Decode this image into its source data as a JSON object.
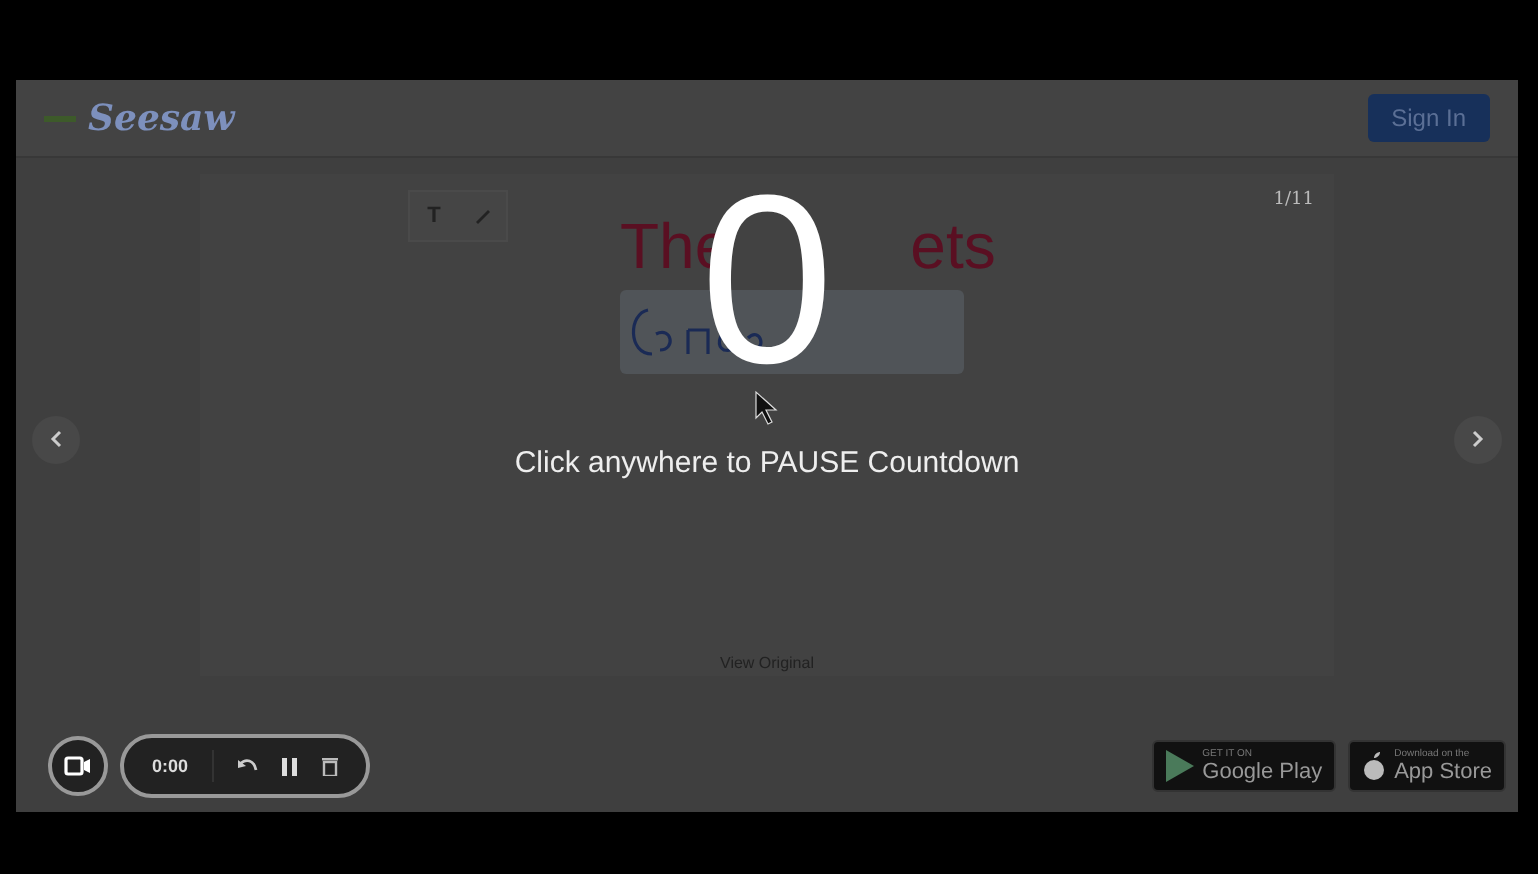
{
  "header": {
    "logo": "Seesaw",
    "sign_in": "Sign In"
  },
  "toolbar": {
    "text_tool": "T"
  },
  "page_counter": "1/11",
  "title_parts": [
    "The",
    "ets"
  ],
  "countdown": {
    "number": "0",
    "message": "Click anywhere to PAUSE Countdown"
  },
  "recorder": {
    "time": "0:00"
  },
  "view_original": "View Original",
  "stores": [
    {
      "kind": "google",
      "small": "GET IT ON",
      "big": "Google Play"
    },
    {
      "kind": "apple",
      "small": "Download on the",
      "big": "App Store"
    }
  ]
}
